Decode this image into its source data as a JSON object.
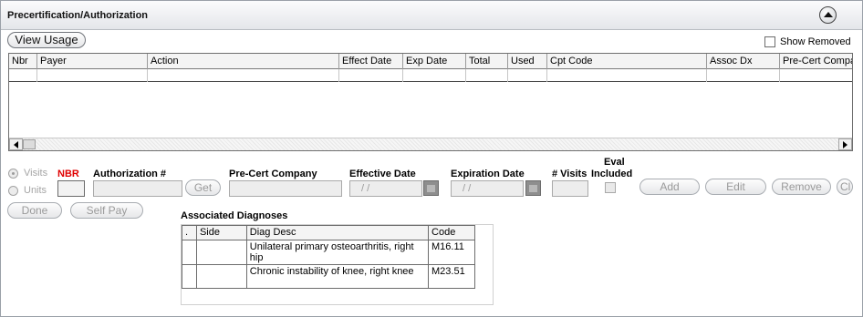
{
  "panel": {
    "title": "Precertification/Authorization",
    "collapse_icon": "collapse-up-icon"
  },
  "toolbar": {
    "view_usage": "View Usage",
    "show_removed": "Show Removed",
    "show_removed_checked": false
  },
  "grid": {
    "columns": [
      "Nbr",
      "Payer",
      "Action",
      "Effect Date",
      "Exp Date",
      "Total",
      "Used",
      "Cpt Code",
      "Assoc Dx",
      "Pre-Cert Compa"
    ],
    "rows": []
  },
  "form": {
    "visits_label": "Visits",
    "units_label": "Units",
    "nbr_label": "NBR",
    "nbr_color": "#e00000",
    "auth_label": "Authorization #",
    "get_button": "Get",
    "precert_label": "Pre-Cert Company",
    "eff_label": "Effective Date",
    "eff_value": "/ /",
    "exp_label": "Expiration Date",
    "exp_value": "/ /",
    "visits_count_label": "# Visits",
    "eval_label_1": "Eval",
    "eval_label_2": "Included",
    "add_button": "Add",
    "edit_button": "Edit",
    "remove_button": "Remove",
    "clear_button": "Cl",
    "done_button": "Done",
    "selfpay_button": "Self Pay"
  },
  "diagnoses": {
    "title": "Associated Diagnoses",
    "columns": [
      ".",
      "Side",
      "Diag Desc",
      "Code"
    ],
    "rows": [
      {
        "dot": "",
        "side": "",
        "desc": "Unilateral primary osteoarthritis, right hip",
        "code": "M16.11"
      },
      {
        "dot": "",
        "side": "",
        "desc": "Chronic instability of knee, right knee",
        "code": "M23.51"
      }
    ]
  }
}
